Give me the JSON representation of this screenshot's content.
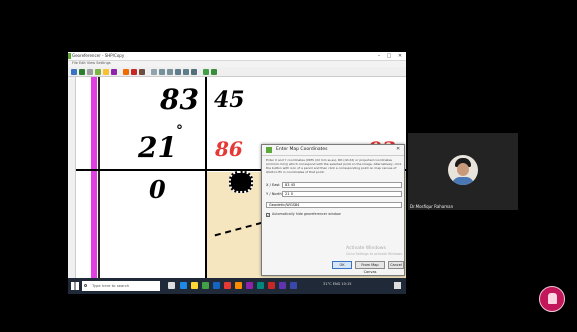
{
  "app": {
    "title": "Georeferencer - SHP/Copy",
    "menus": "File   Edit   View   Settings",
    "window_controls": [
      "–",
      "□",
      "✕"
    ]
  },
  "map": {
    "labels": [
      "83",
      "45",
      "21",
      "°",
      "0",
      "86"
    ],
    "red_label": "93"
  },
  "dialog": {
    "title": "Enter Map Coordinates",
    "description": "Enter X and Y coordinates (DMS (dd mm ss.ss), DD (dd.dd) or projected coordinates (mmmm.mm)) which correspond with the selected point on the image. Alternatively, click the button with icon of a pencil and then click a corresponding point on map canvas of QGIS to fill in coordinates of that point.",
    "x_label": "X / East",
    "x_value": "83 45",
    "y_label": "Y / North",
    "y_value": "21 0",
    "crs_value": "Geodetic/WGS84",
    "checkbox_label": "Automatically hide georeferencer window",
    "watermark_line1": "Activate Windows",
    "watermark_line2": "Go to Settings to activate Windows.",
    "ok_label": "OK",
    "canvas_label": "From Map Canvas",
    "cancel_label": "Cancel"
  },
  "taskbar": {
    "search_placeholder": "Type here to search",
    "tray_text": "31°C   ENG   10:15"
  },
  "participant": {
    "name": "Dr.Mosfiqur Rahaman"
  },
  "colors": {
    "magenta_line": "#e040e0",
    "red_label": "#e53935",
    "map_beige": "#f5e6c0",
    "taskbar": "#1f2937",
    "logo": "#c2185b"
  },
  "icons": [
    "windows-start-icon",
    "search-icon",
    "avatar-icon",
    "university-logo-icon",
    "checkbox-icon",
    "dialog-app-icon"
  ]
}
